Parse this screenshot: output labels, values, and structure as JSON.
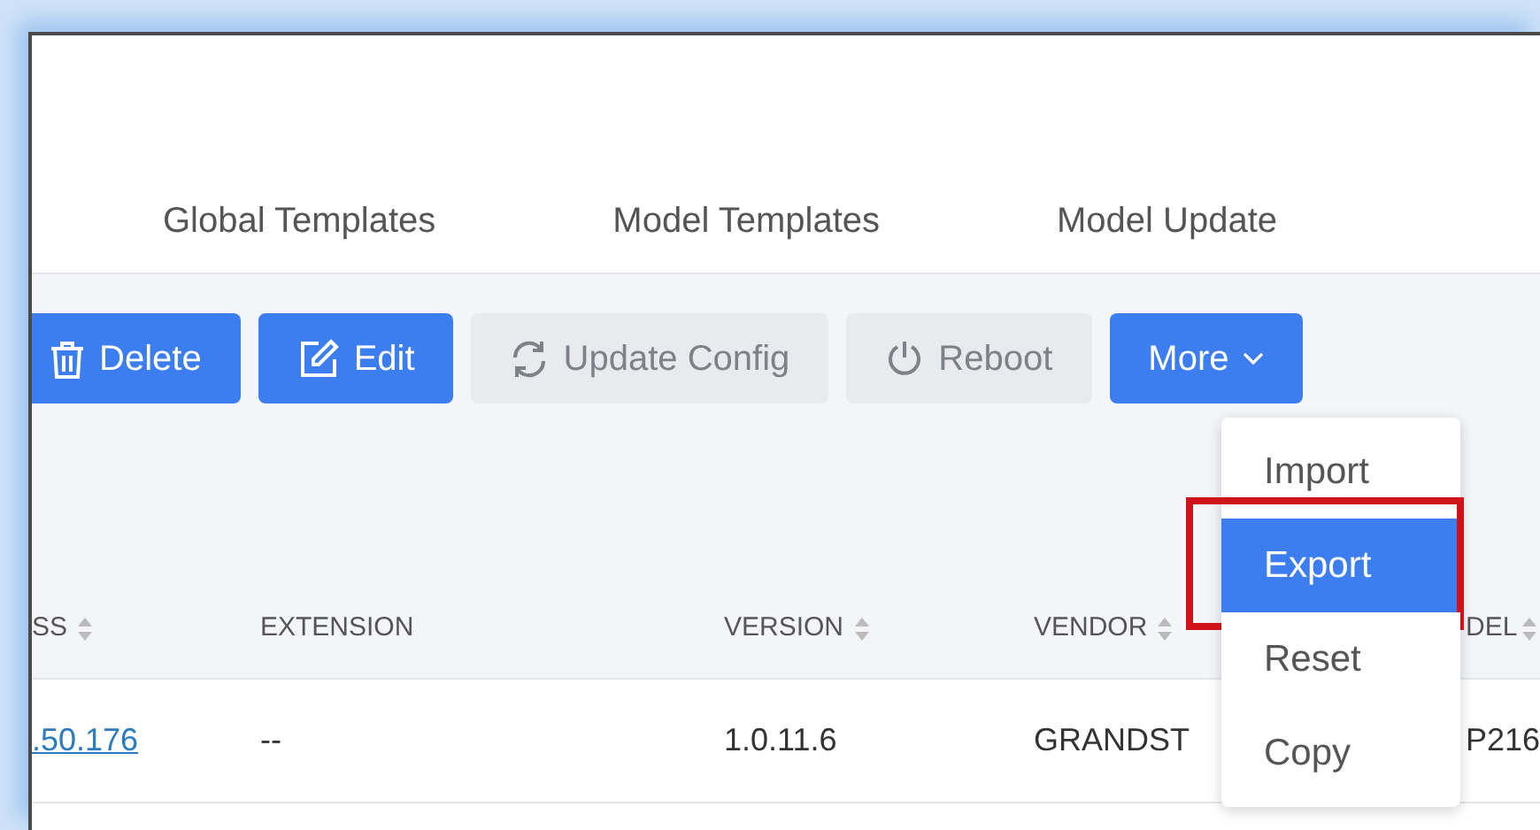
{
  "tabs": [
    {
      "label": "Global Templates"
    },
    {
      "label": "Model Templates"
    },
    {
      "label": "Model Update"
    }
  ],
  "toolbar": [
    {
      "label": "Delete",
      "disabled": false,
      "kind": "button"
    },
    {
      "label": "Edit",
      "disabled": false,
      "kind": "button"
    },
    {
      "label": "Update Config",
      "disabled": true,
      "kind": "button"
    },
    {
      "label": "Reboot",
      "disabled": true,
      "kind": "button"
    },
    {
      "label": "More",
      "disabled": false,
      "kind": "dropdown"
    }
  ],
  "more_menu": [
    {
      "label": "Import",
      "selected": false,
      "annotated": false
    },
    {
      "label": "Export",
      "selected": true,
      "annotated": true
    },
    {
      "label": "Reset",
      "selected": false,
      "annotated": false
    },
    {
      "label": "Copy",
      "selected": false,
      "annotated": false
    }
  ],
  "table": {
    "columns": [
      {
        "label": "SS",
        "sortable": true
      },
      {
        "label": "EXTENSION",
        "sortable": false
      },
      {
        "label": "VERSION",
        "sortable": true
      },
      {
        "label": "VENDOR",
        "sortable": true
      },
      {
        "label": "DEL",
        "sortable": true
      }
    ],
    "rows": [
      {
        "cells": [
          {
            "text": ".50.176",
            "link": true
          },
          {
            "text": "--",
            "link": false
          },
          {
            "text": "1.0.11.6",
            "link": false
          },
          {
            "text": "GRANDST",
            "link": false
          },
          {
            "text": "P216",
            "link": false
          }
        ]
      }
    ]
  }
}
